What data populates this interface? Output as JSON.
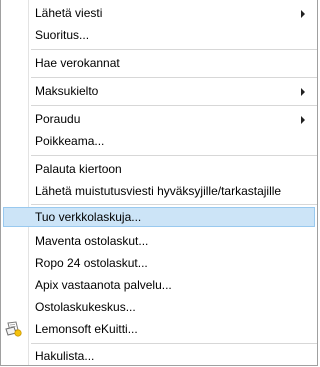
{
  "menu": {
    "items": [
      {
        "label": "Lähetä viesti",
        "submenu": true
      },
      {
        "label": "Suoritus..."
      },
      {
        "label": "Hae verokannat"
      },
      {
        "label": "Maksukielto",
        "submenu": true
      },
      {
        "label": "Poraudu",
        "submenu": true
      },
      {
        "label": "Poikkeama..."
      },
      {
        "label": "Palauta kiertoon"
      },
      {
        "label": "Lähetä muistutusviesti hyväksyjille/tarkastajille"
      },
      {
        "label": "Tuo verkkolaskuja...",
        "selected": true
      },
      {
        "label": "Maventa ostolaskut..."
      },
      {
        "label": "Ropo 24 ostolaskut..."
      },
      {
        "label": "Apix vastaanota palvelu..."
      },
      {
        "label": "Ostolaskukeskus..."
      },
      {
        "label": "Lemonsoft eKuitti...",
        "icon": "receipt-icon"
      },
      {
        "label": "Hakulista..."
      }
    ]
  },
  "colors": {
    "highlight_fill": "#cce4f7",
    "highlight_border": "#99c9ef",
    "separator": "#d7d7d7"
  }
}
